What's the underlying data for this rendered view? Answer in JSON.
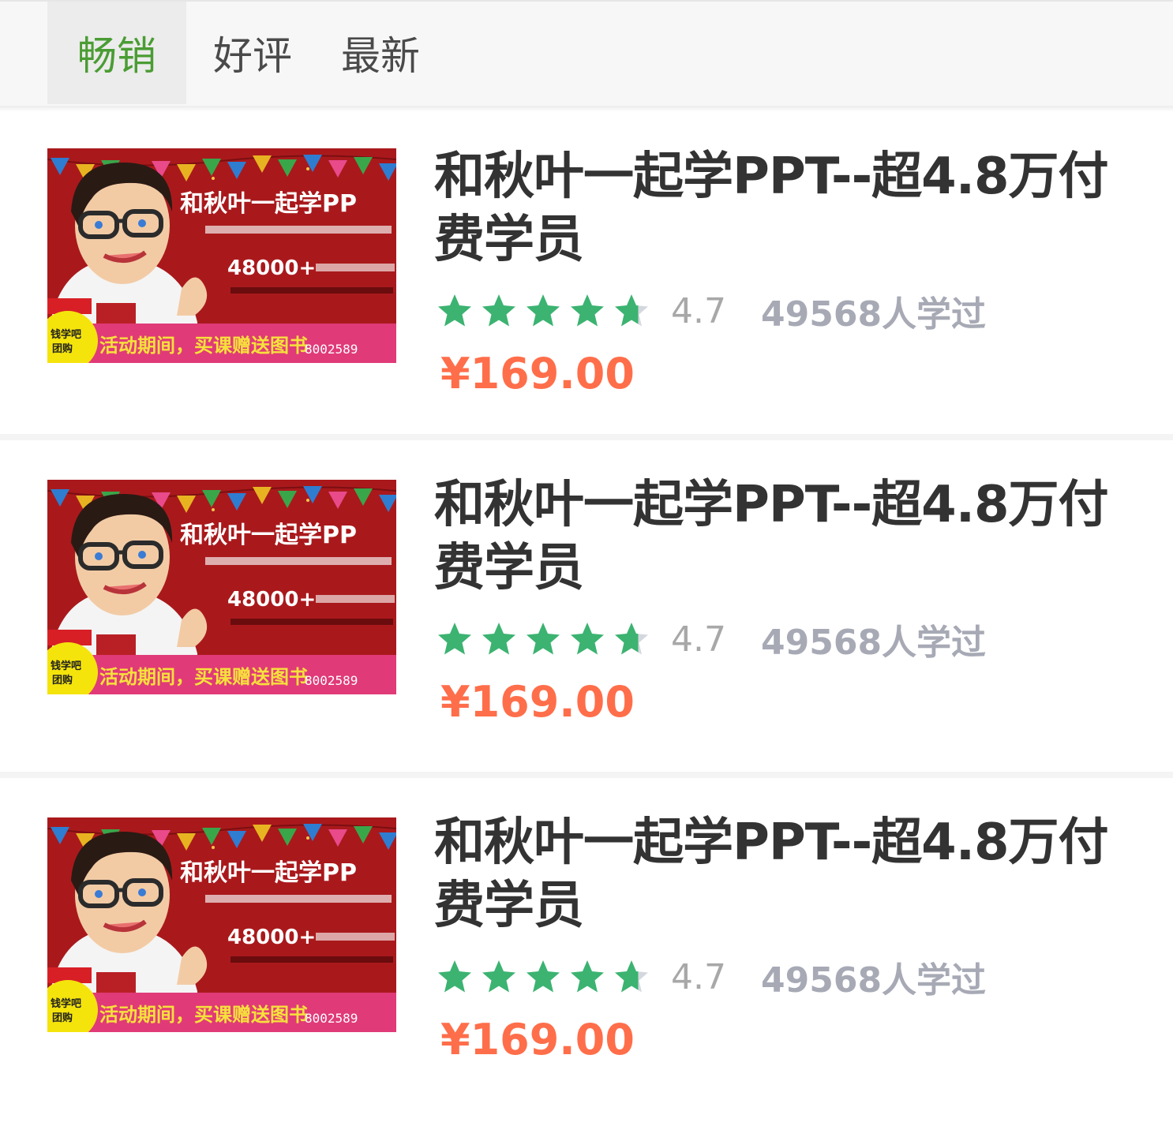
{
  "tabs": [
    {
      "label": "畅销",
      "active": true
    },
    {
      "label": "好评",
      "active": false
    },
    {
      "label": "最新",
      "active": false
    }
  ],
  "colors": {
    "tab_active": "#4a9c33",
    "star": "#3cb371",
    "price": "#ff6e4a",
    "muted": "#a8a8a8"
  },
  "courses": [
    {
      "title": "和秋叶一起学PPT--超4.8万付费学员",
      "rating": "4.7",
      "rating_value": 4.7,
      "learners": "49568人学过",
      "price": "¥169.00",
      "thumbnail": {
        "heading": "和秋叶一起学PP",
        "count": "48000+",
        "banner": "活动期间，买课赠送图书",
        "badge": "钱学吧 团购",
        "contact": "8002589"
      }
    },
    {
      "title": "和秋叶一起学PPT--超4.8万付费学员",
      "rating": "4.7",
      "rating_value": 4.7,
      "learners": "49568人学过",
      "price": "¥169.00",
      "thumbnail": {
        "heading": "和秋叶一起学PP",
        "count": "48000+",
        "banner": "活动期间，买课赠送图书",
        "badge": "钱学吧 团购",
        "contact": "8002589"
      }
    },
    {
      "title": "和秋叶一起学PPT--超4.8万付费学员",
      "rating": "4.7",
      "rating_value": 4.7,
      "learners": "49568人学过",
      "price": "¥169.00",
      "thumbnail": {
        "heading": "和秋叶一起学PP",
        "count": "48000+",
        "banner": "活动期间，买课赠送图书",
        "badge": "钱学吧 团购",
        "contact": "8002589"
      }
    }
  ]
}
